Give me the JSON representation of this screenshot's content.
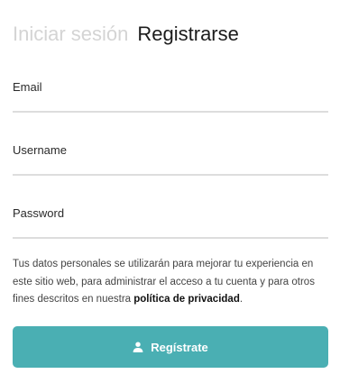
{
  "tabs": [
    {
      "label": "Iniciar sesión",
      "active": false
    },
    {
      "label": "Registrarse",
      "active": true
    }
  ],
  "fields": {
    "email": {
      "label": "Email",
      "value": ""
    },
    "username": {
      "label": "Username",
      "value": ""
    },
    "password": {
      "label": "Password",
      "value": ""
    }
  },
  "privacy": {
    "text_before": "Tus datos personales se utilizarán para mejorar tu experiencia en este sitio web, para administrar el acceso a tu cuenta y para otros fines descritos en nuestra ",
    "link_label": "política de privacidad",
    "text_after": "."
  },
  "submit": {
    "label": "Regístrate",
    "icon": "user-icon"
  },
  "colors": {
    "accent": "#4aafb3",
    "inactive_tab": "#d4d4d4",
    "underline": "#dddddd"
  }
}
